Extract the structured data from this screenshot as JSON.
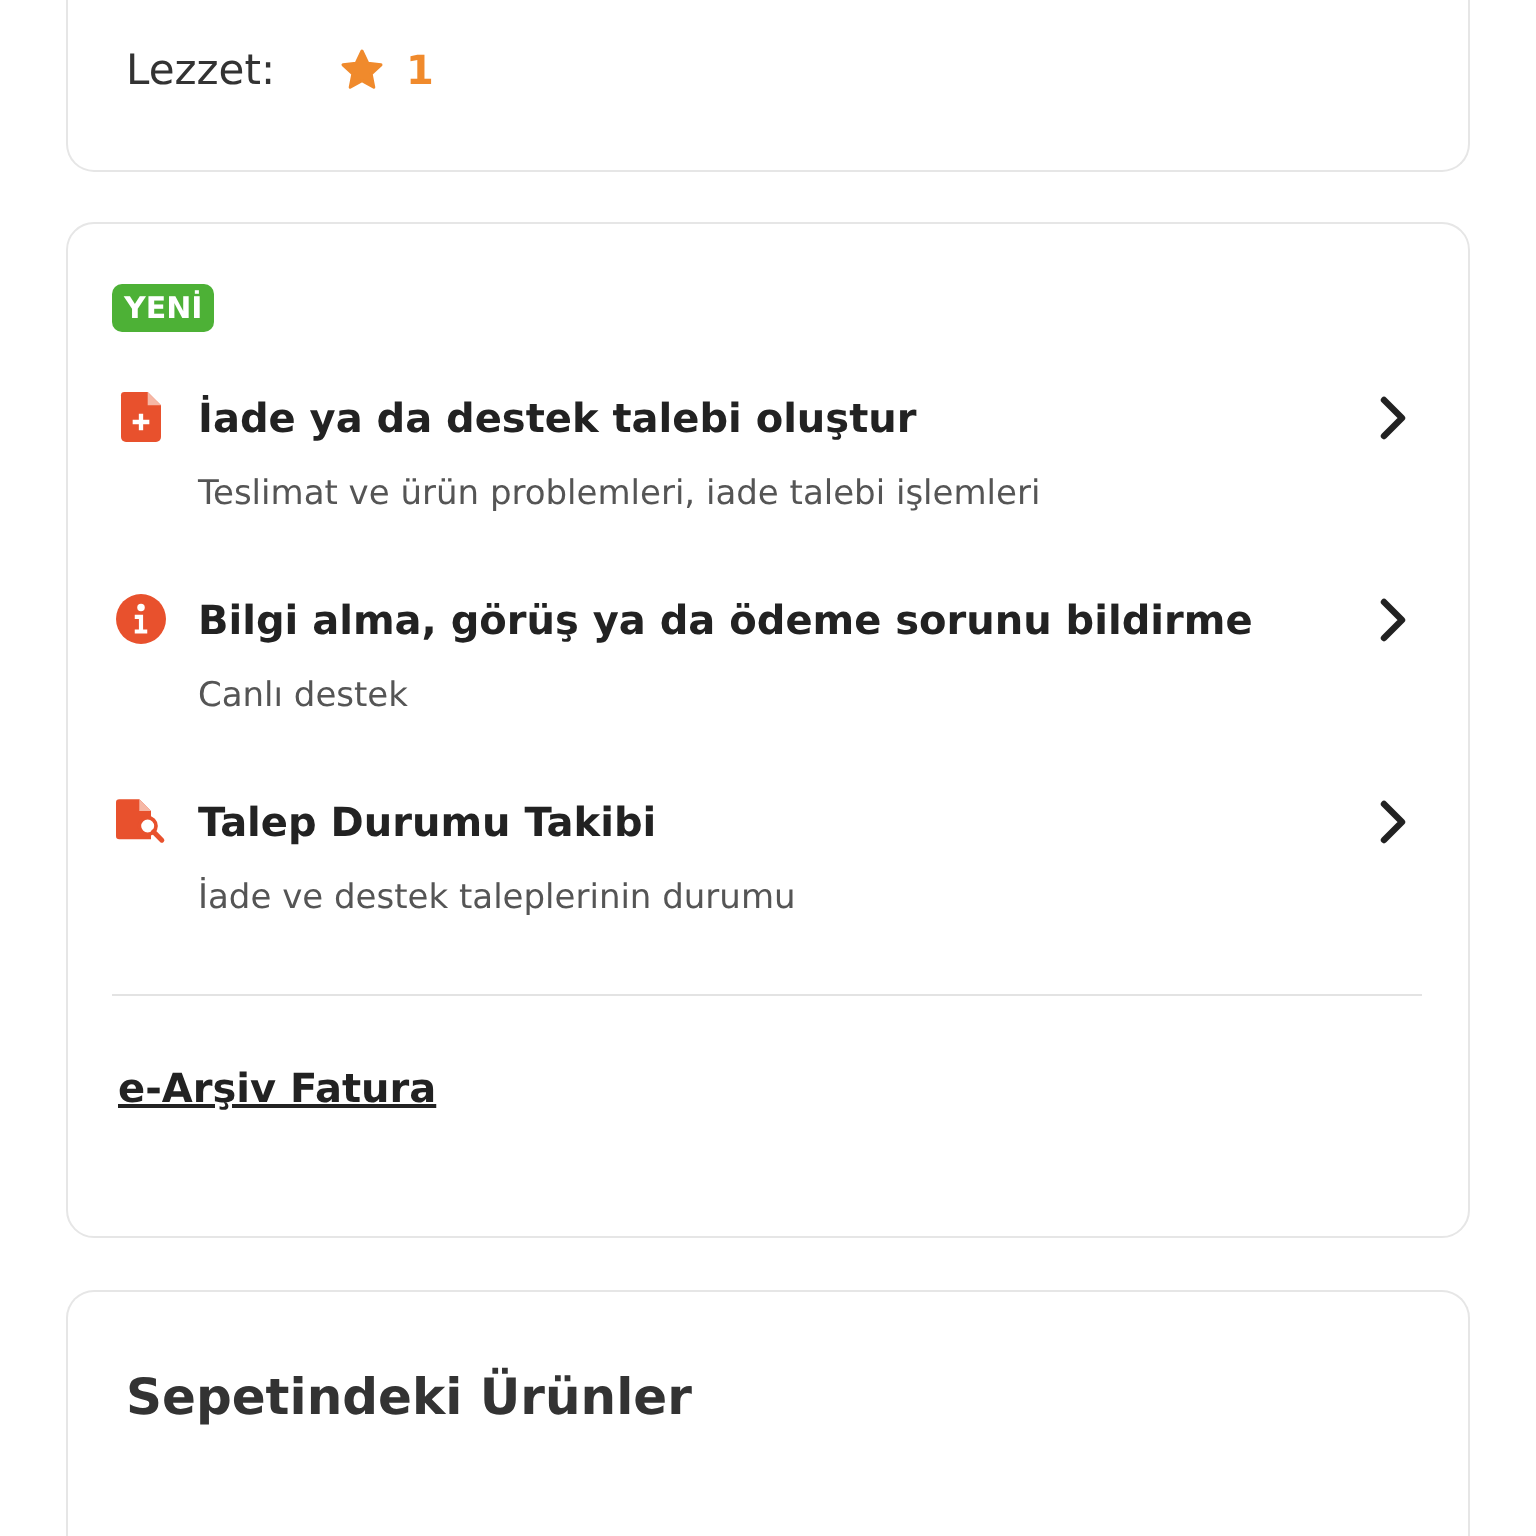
{
  "ratings": [
    {
      "label": "Lezzet:",
      "value": "1"
    }
  ],
  "support": {
    "badge": "YENİ",
    "items": [
      {
        "kind": "document-plus",
        "title": "İade ya da destek talebi oluştur",
        "subtitle": "Teslimat ve ürün problemleri, iade talebi işlemleri"
      },
      {
        "kind": "info",
        "title": "Bilgi alma, görüş ya da ödeme sorunu bildirme",
        "subtitle": "Canlı destek"
      },
      {
        "kind": "document-search",
        "title": "Talep Durumu Takibi",
        "subtitle": "İade ve destek taleplerinin durumu"
      }
    ],
    "link": "e-Arşiv Fatura"
  },
  "cart": {
    "title": "Sepetindeki Ürünler"
  }
}
